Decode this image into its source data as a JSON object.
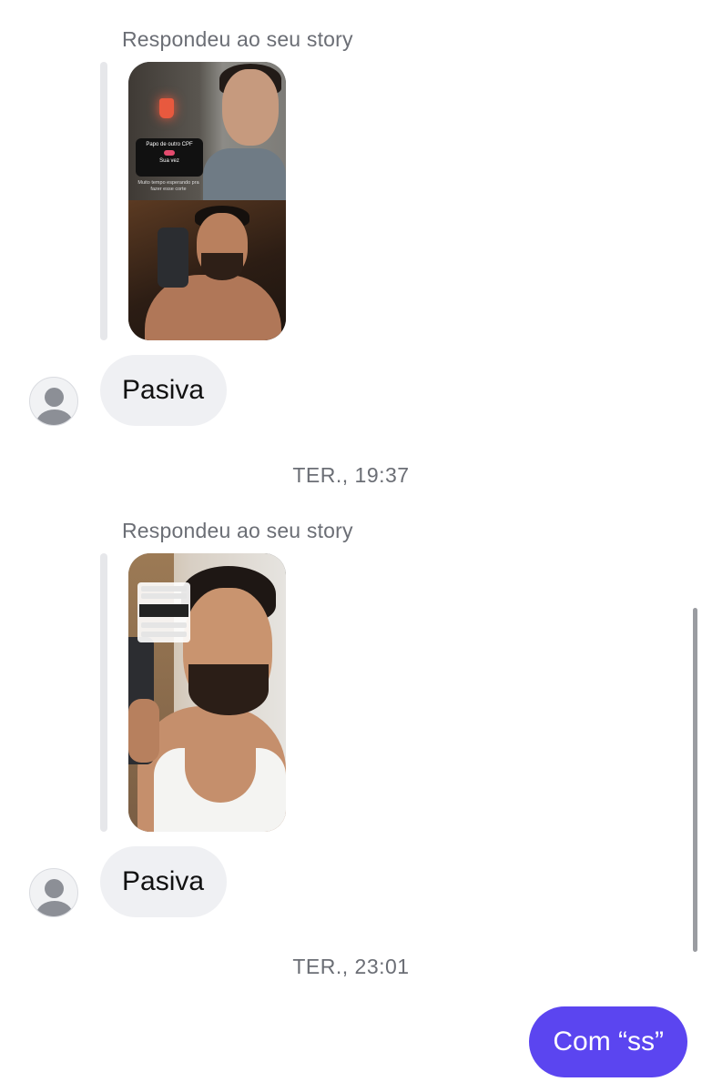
{
  "messages": [
    {
      "reply_label": "Respondeu ao seu story",
      "story": {
        "card_title": "Papo de outro CPF",
        "card_button": "Sua vez",
        "caption": "Muito tempo esperando pra fazer esse corte"
      },
      "text": "Pasiva"
    },
    {
      "timestamp": "TER., 19:37",
      "reply_label": "Respondeu ao seu story",
      "text": "Pasiva"
    },
    {
      "timestamp": "TER., 23:01",
      "outgoing_text": "Com “ss”"
    }
  ],
  "colors": {
    "incoming_bubble": "#eff0f3",
    "outgoing_bubble": "#5b45f0",
    "meta_text": "#6b6e75"
  },
  "icons": {
    "avatar": "person-silhouette-icon"
  }
}
